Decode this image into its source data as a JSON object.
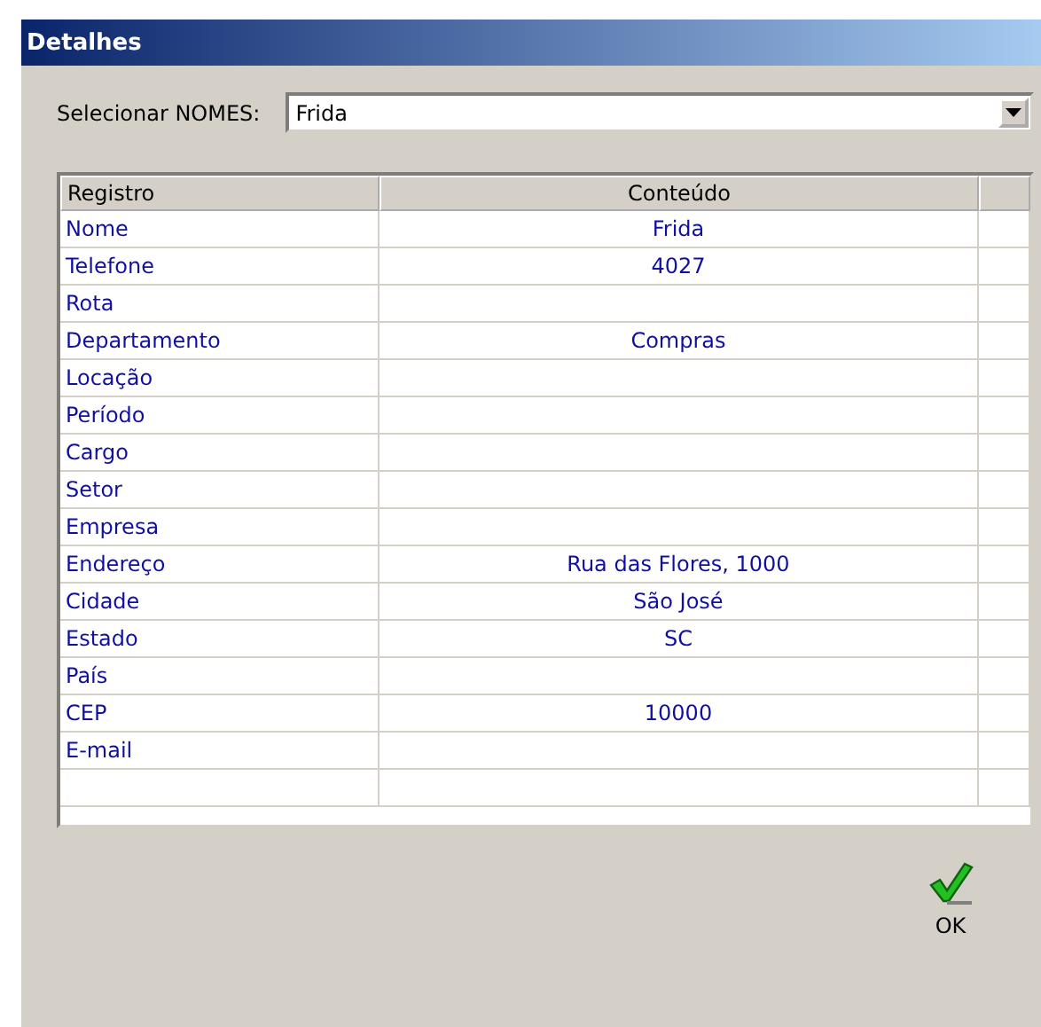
{
  "window": {
    "title": "Detalhes"
  },
  "selector": {
    "label": "Selecionar NOMES:",
    "value": "Frida"
  },
  "table": {
    "columns": [
      "Registro",
      "Conteúdo"
    ],
    "rows": [
      {
        "field": "Nome",
        "value": "Frida"
      },
      {
        "field": "Telefone",
        "value": "4027"
      },
      {
        "field": "Rota",
        "value": ""
      },
      {
        "field": "Departamento",
        "value": "Compras"
      },
      {
        "field": "Locação",
        "value": ""
      },
      {
        "field": "Período",
        "value": ""
      },
      {
        "field": "Cargo",
        "value": ""
      },
      {
        "field": "Setor",
        "value": ""
      },
      {
        "field": "Empresa",
        "value": ""
      },
      {
        "field": "Endereço",
        "value": "Rua das Flores, 1000"
      },
      {
        "field": "Cidade",
        "value": "São José"
      },
      {
        "field": "Estado",
        "value": "SC"
      },
      {
        "field": "País",
        "value": ""
      },
      {
        "field": "CEP",
        "value": "10000"
      },
      {
        "field": "E-mail",
        "value": ""
      }
    ]
  },
  "ok_button": {
    "label": "OK"
  }
}
